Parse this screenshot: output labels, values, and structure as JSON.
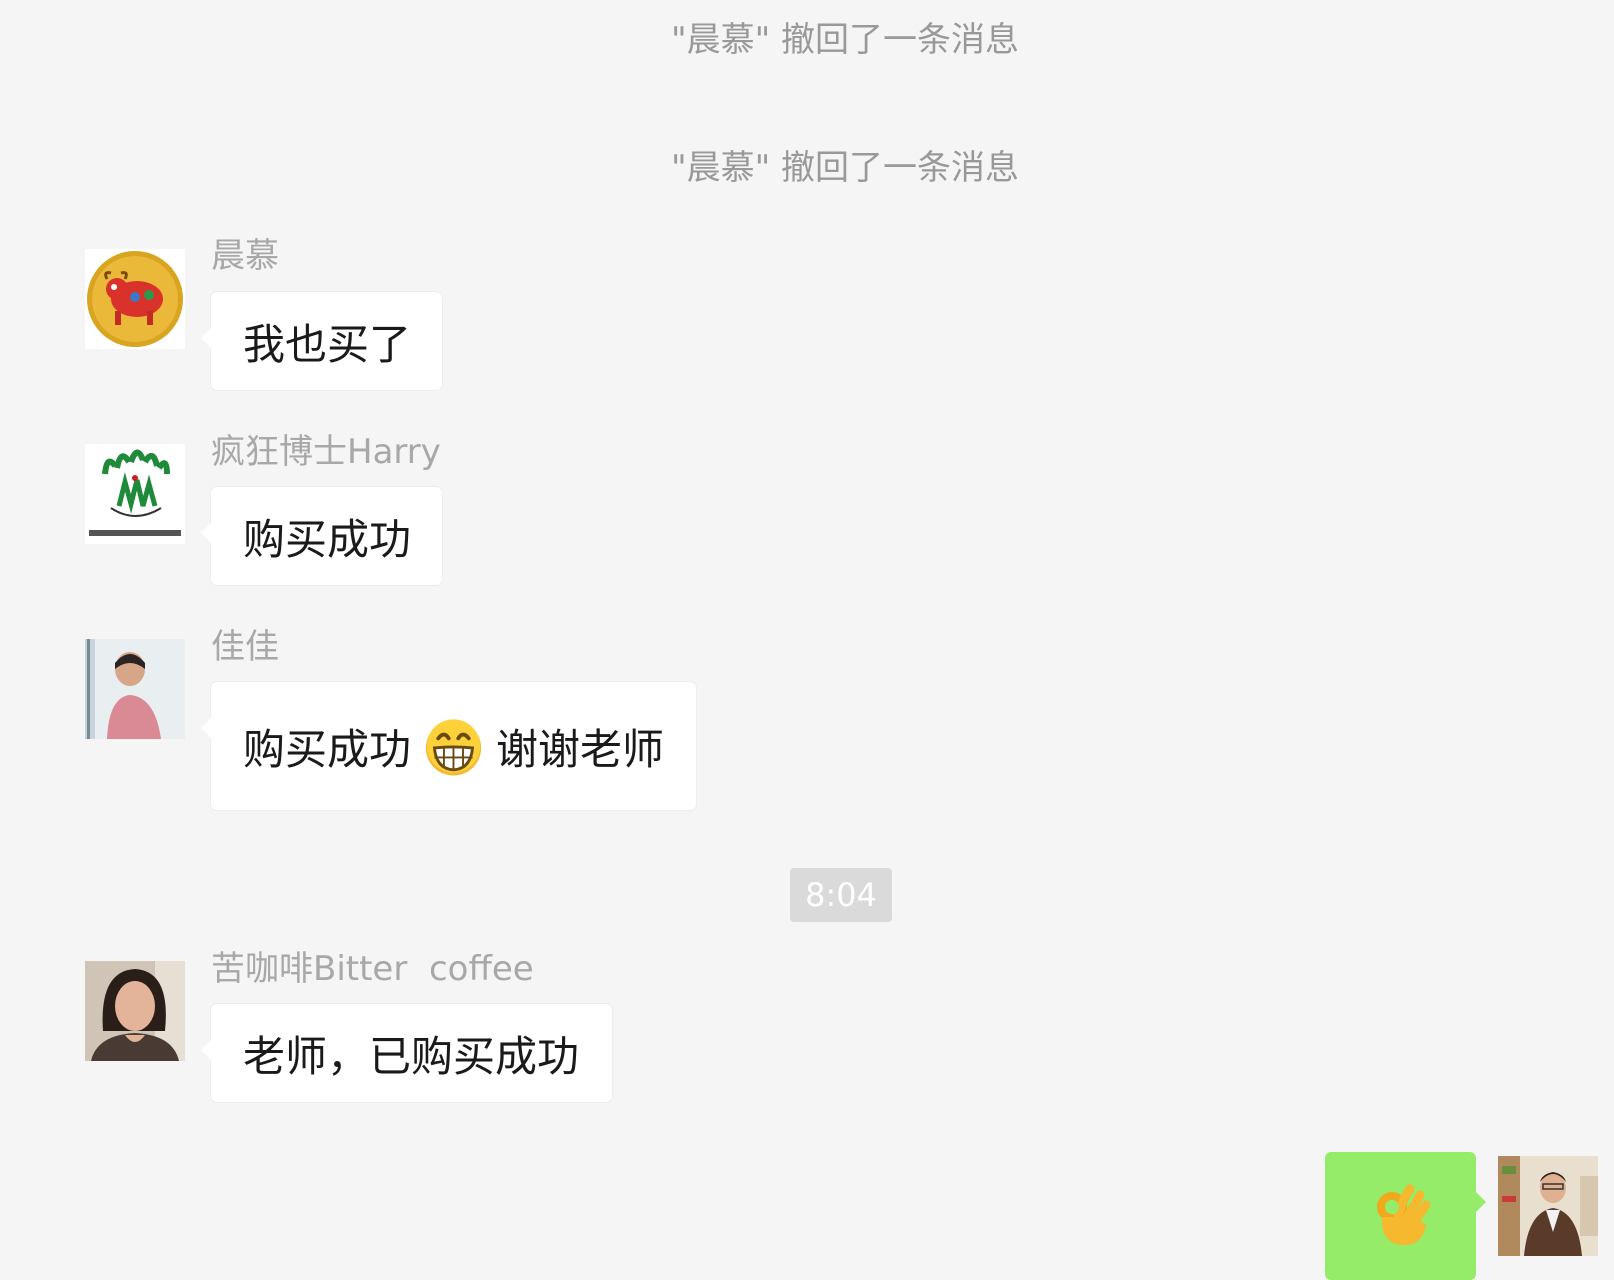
{
  "notices": [
    {
      "text": "\"晨慕\" 撤回了一条消息"
    },
    {
      "text": "\"晨慕\" 撤回了一条消息"
    }
  ],
  "messages": [
    {
      "sender": "晨慕",
      "text": "我也买了",
      "avatar_icon": "ox-coin-icon"
    },
    {
      "sender": "疯狂博士Harry",
      "text": "购买成功",
      "avatar_icon": "dream-logo-icon"
    },
    {
      "sender": "佳佳",
      "text_before": "购买成功",
      "emoji": "grinning-face-emoji",
      "text_after": "谢谢老师",
      "avatar_icon": "person-photo-icon"
    },
    {
      "sender": "苦咖啡Bitter  coffee",
      "text": "老师，已购买成功",
      "avatar_icon": "person-photo-icon"
    }
  ],
  "timestamp": "8:04",
  "my_message": {
    "emoji": "ok-hand-emoji",
    "bubble_color": "#95ec69"
  },
  "colors": {
    "background": "#f5f5f5",
    "notice_text": "#999999",
    "bubble": "#ffffff"
  }
}
